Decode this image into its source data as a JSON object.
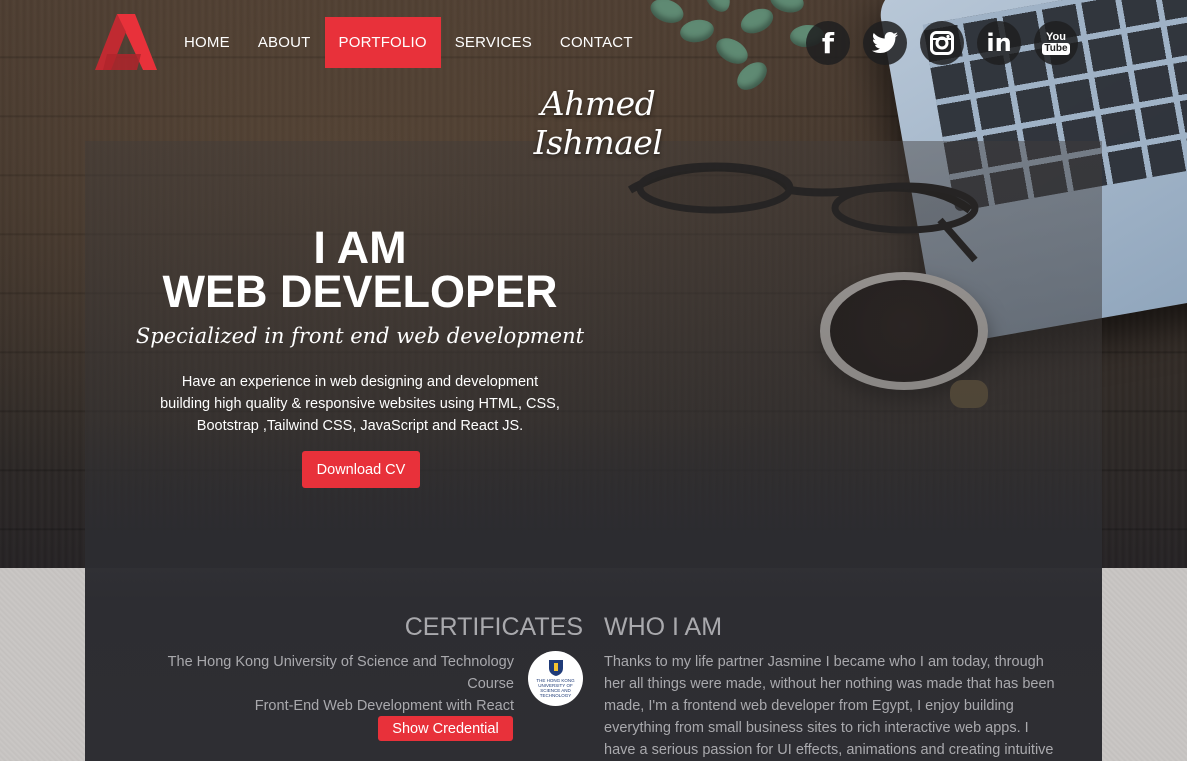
{
  "nav": {
    "items": [
      {
        "label": "HOME",
        "active": false
      },
      {
        "label": "ABOUT",
        "active": false
      },
      {
        "label": "PORTFOLIO",
        "active": true
      },
      {
        "label": "SERVICES",
        "active": false
      },
      {
        "label": "CONTACT",
        "active": false
      }
    ]
  },
  "social": {
    "items": [
      {
        "icon": "facebook-icon",
        "glyph": "f"
      },
      {
        "icon": "twitter-icon",
        "glyph": ""
      },
      {
        "icon": "instagram-icon",
        "glyph": ""
      },
      {
        "icon": "linkedin-icon",
        "glyph": "in"
      },
      {
        "icon": "youtube-icon",
        "glyph_top": "You",
        "glyph_bottom": "Tube"
      }
    ]
  },
  "brand": {
    "name": "Ahmed Ishmael"
  },
  "hero": {
    "title_line1": "I AM",
    "title_line2": "WEB DEVELOPER",
    "subtitle": "Specialized in front end web development",
    "desc_line1": "Have an experience in web designing and development",
    "desc_line2": "building high quality & responsive websites using HTML, CSS,",
    "desc_line3": "Bootstrap ,Tailwind CSS, JavaScript and React JS.",
    "cta_label": "Download CV"
  },
  "certificates": {
    "heading": "CERTIFICATES",
    "institution_line1": "The Hong Kong University of Science and Technology",
    "institution_line2": "Course",
    "course": "Front-End Web Development with React",
    "logo_text": "THE HONG KONG UNIVERSITY OF SCIENCE AND TECHNOLOGY",
    "button_label": "Show Credential"
  },
  "who": {
    "heading": "WHO I AM",
    "line1": "Thanks to my life partner Jasmine I became who I am today, through",
    "line2": "her all things were made, without her nothing was made that has been",
    "line3": "made, I'm a frontend web developer from Egypt, I enjoy building",
    "line4": "everything from small business sites to rich interactive web apps. I",
    "line5": "have a serious passion for UI effects, animations and creating intuitive"
  },
  "colors": {
    "accent": "#e8313a",
    "panel": "#2d2d32",
    "muted_text": "#a9a9ad"
  }
}
